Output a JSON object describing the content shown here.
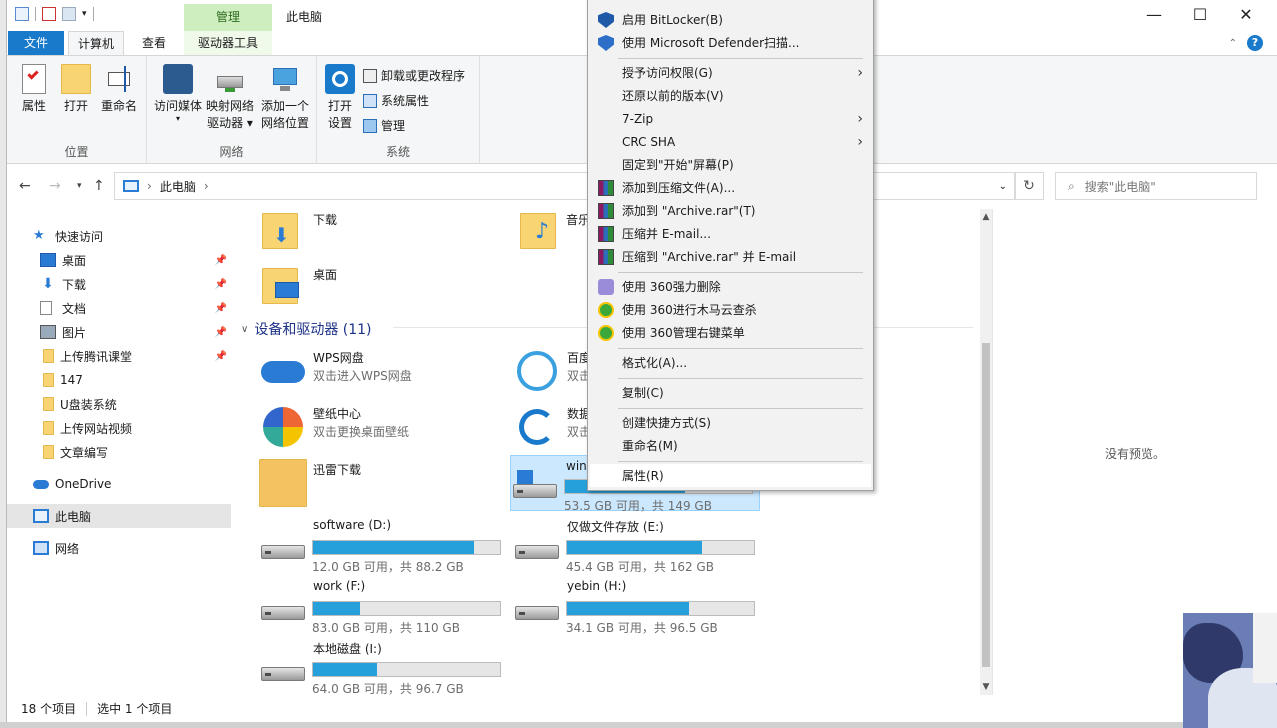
{
  "window": {
    "title": "此电脑",
    "context_tab_label": "管理",
    "minimize": "—",
    "maximize": "☐",
    "close": "✕"
  },
  "tabs": {
    "file": "文件",
    "computer": "计算机",
    "view": "查看",
    "drive_tools": "驱动器工具"
  },
  "ribbon": {
    "location": {
      "label": "位置",
      "properties": "属性",
      "open": "打开",
      "rename": "重命名"
    },
    "network": {
      "label": "网络",
      "access_media": "访问媒体",
      "map_drive_1": "映射网络",
      "map_drive_2": "驱动器",
      "add_location_1": "添加一个",
      "add_location_2": "网络位置"
    },
    "system": {
      "label": "系统",
      "open_settings_1": "打开",
      "open_settings_2": "设置",
      "uninstall": "卸载或更改程序",
      "system_props": "系统属性",
      "manage": "管理"
    }
  },
  "address": {
    "crumb": "此电脑",
    "search_placeholder": "搜索\"此电脑\""
  },
  "nav": {
    "quick_access": "快速访问",
    "items": [
      {
        "label": "桌面"
      },
      {
        "label": "下载"
      },
      {
        "label": "文档"
      },
      {
        "label": "图片"
      },
      {
        "label": "上传腾讯课堂"
      },
      {
        "label": "147"
      },
      {
        "label": "U盘装系统"
      },
      {
        "label": "上传网站视频"
      },
      {
        "label": "文章编写"
      }
    ],
    "onedrive": "OneDrive",
    "this_pc": "此电脑",
    "network": "网络"
  },
  "content": {
    "folders": [
      {
        "name": "下载"
      },
      {
        "name": "音乐"
      },
      {
        "name": "桌面"
      }
    ],
    "section_title": "设备和驱动器 (11)",
    "apps": [
      {
        "name": "WPS网盘",
        "sub": "双击进入WPS网盘"
      },
      {
        "name": "百度",
        "sub": "双击"
      },
      {
        "name": "壁纸中心",
        "sub": "双击更换桌面壁纸"
      },
      {
        "name": "数据",
        "sub": "双击"
      },
      {
        "name": "迅雷下载",
        "sub": ""
      }
    ],
    "drives": [
      {
        "name": "win",
        "info": "53.5 GB 可用，共 149 GB",
        "used": 0.64
      },
      {
        "name": "software (D:)",
        "info": "12.0 GB 可用，共 88.2 GB",
        "used": 0.86
      },
      {
        "name": "仅做文件存放 (E:)",
        "info": "45.4 GB 可用，共 162 GB",
        "used": 0.72
      },
      {
        "name": "work (F:)",
        "info": "83.0 GB 可用，共 110 GB",
        "used": 0.25
      },
      {
        "name": "yebin (H:)",
        "info": "34.1 GB 可用，共 96.5 GB",
        "used": 0.65
      },
      {
        "name": "本地磁盘 (I:)",
        "info": "64.0 GB 可用，共 96.7 GB",
        "used": 0.34
      }
    ]
  },
  "preview": {
    "text": "没有预览。"
  },
  "status": {
    "count": "18 个项目",
    "selected": "选中 1 个项目"
  },
  "context_menu": {
    "items": [
      {
        "label": "启用 BitLocker(B)"
      },
      {
        "label": "使用 Microsoft Defender扫描..."
      },
      {
        "label": "授予访问权限(G)"
      },
      {
        "label": "还原以前的版本(V)"
      },
      {
        "label": "7-Zip"
      },
      {
        "label": "CRC SHA"
      },
      {
        "label": "固定到\"开始\"屏幕(P)"
      },
      {
        "label": "添加到压缩文件(A)..."
      },
      {
        "label": "添加到 \"Archive.rar\"(T)"
      },
      {
        "label": "压缩并 E-mail..."
      },
      {
        "label": "压缩到 \"Archive.rar\" 并 E-mail"
      },
      {
        "label": "使用 360强力删除"
      },
      {
        "label": "使用 360进行木马云查杀"
      },
      {
        "label": "使用 360管理右键菜单"
      },
      {
        "label": "格式化(A)..."
      },
      {
        "label": "复制(C)"
      },
      {
        "label": "创建快捷方式(S)"
      },
      {
        "label": "重命名(M)"
      },
      {
        "label": "属性(R)"
      }
    ]
  },
  "colors": {
    "accent": "#1979ca",
    "drive_fill": "#26a0da",
    "context_tab": "#cfeec0"
  }
}
